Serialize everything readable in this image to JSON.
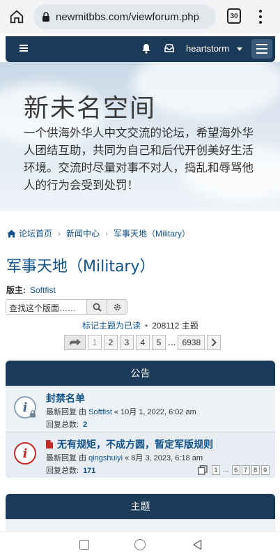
{
  "browser": {
    "url": "newmitbbs.com/viewforum.php",
    "tab_count": "30"
  },
  "nav": {
    "username": "heartstorm"
  },
  "banner": {
    "title": "新未名空间",
    "description": "一个供海外华人中文交流的论坛，希望海外华人团结互助，共同为自己和后代开创美好生活环境。交流时尽量对事不对人，捣乱和辱骂他人的行为会受到处罚！"
  },
  "breadcrumb": [
    "论坛首页",
    "新闻中心",
    "军事天地（Military）"
  ],
  "forum": {
    "title": "军事天地（Military）",
    "moderator_label": "版主:",
    "moderator": "Softfist",
    "search_placeholder": "查找这个版面……",
    "mark_read": "标记主题为已读",
    "topic_count": "208112 主题"
  },
  "pagination": {
    "pages": [
      "1",
      "2",
      "3",
      "4",
      "5",
      "...",
      "6938"
    ],
    "current": "1"
  },
  "announcements": {
    "header": "公告",
    "items": [
      {
        "title": "封禁名单",
        "last_reply_prefix": "最新回复 由",
        "author": "Softfist",
        "date": "« 10月 1, 2022, 6:02 am",
        "replies_label": "回复总数:",
        "replies": "2",
        "icon": "info-locked-icon"
      },
      {
        "title": "无有规矩，不成方圆，暂定军版规则",
        "last_reply_prefix": "最新回复 由",
        "author": "qingshuiyi",
        "date": "« 8月 3, 2023, 6:18 am",
        "replies_label": "回复总数:",
        "replies": "171",
        "icon": "info-red-icon",
        "mini_pages": [
          "1",
          "...",
          "6",
          "7",
          "8",
          "9"
        ]
      }
    ]
  },
  "topics": {
    "header": "主题"
  },
  "colors": {
    "navbar": "#1b3a57",
    "link": "#105289",
    "alert_red": "#c22a2a"
  }
}
